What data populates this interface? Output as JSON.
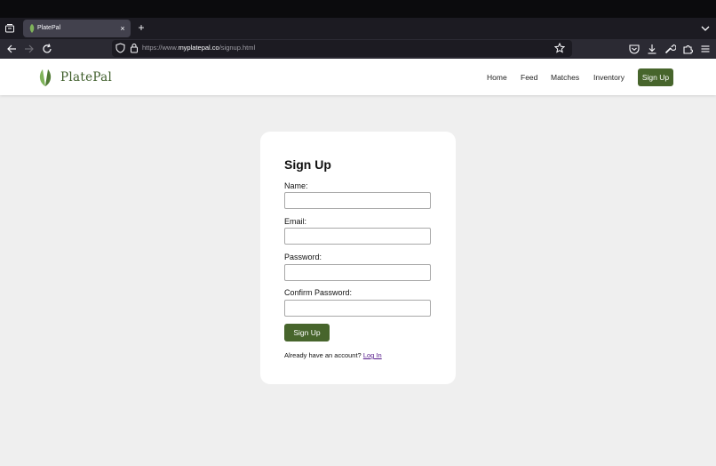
{
  "browser": {
    "tab": {
      "title": "PlatePal",
      "close_glyph": "×"
    },
    "new_tab_glyph": "+",
    "url": {
      "prefix": "https://www.",
      "host": "myplatepal.co",
      "path": "/signup.html"
    },
    "icons": [
      "tab-list-icon",
      "back-icon",
      "forward-icon",
      "reload-icon",
      "shield-icon",
      "lock-icon",
      "star-icon",
      "pocket-icon",
      "download-icon",
      "wrench-icon",
      "extensions-icon",
      "menu-icon",
      "chevron-down-icon"
    ]
  },
  "site": {
    "brand": "PlatePal",
    "nav": [
      "Home",
      "Feed",
      "Matches",
      "Inventory"
    ],
    "cta": "Sign Up",
    "colors": {
      "brand_green": "#47652c",
      "leaf_light": "#7fb35a",
      "leaf_dark": "#4f7a33",
      "page_bg": "#efefef"
    }
  },
  "form": {
    "title": "Sign Up",
    "fields": [
      {
        "label": "Name:",
        "value": ""
      },
      {
        "label": "Email:",
        "value": ""
      },
      {
        "label": "Password:",
        "value": ""
      },
      {
        "label": "Confirm Password:",
        "value": ""
      }
    ],
    "submit": "Sign Up",
    "login_prompt": "Already have an account?",
    "login_link": "Log In"
  }
}
